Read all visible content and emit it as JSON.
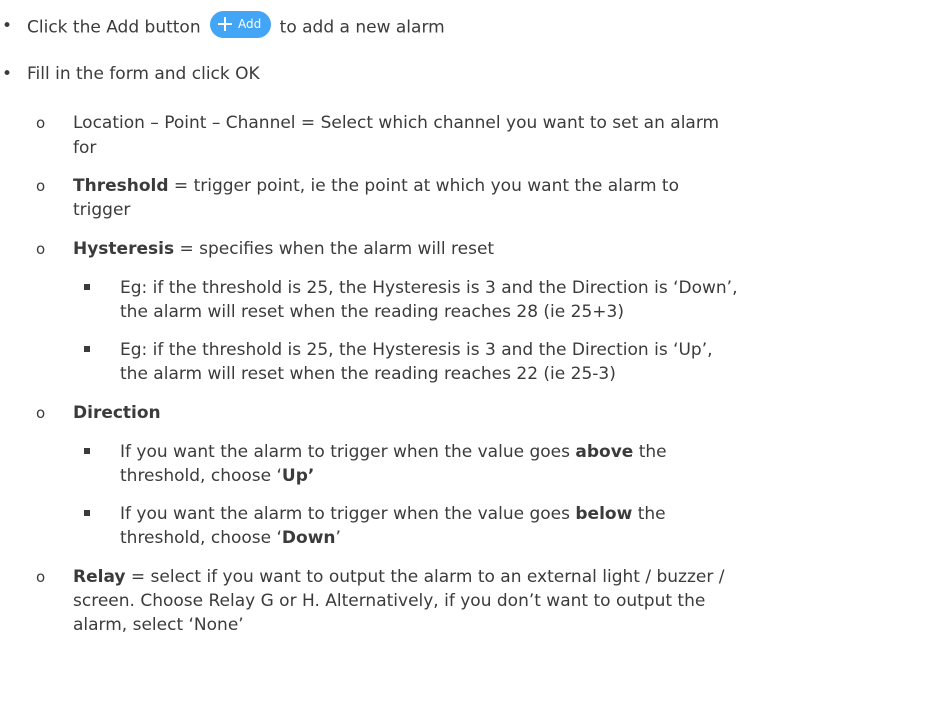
{
  "bullets": {
    "level1_marker": "•",
    "level2_marker": "o"
  },
  "step1": {
    "before": "Click the Add button",
    "button_label": "Add",
    "after": "to add a new alarm"
  },
  "step2": {
    "text": "Fill in the form and click OK"
  },
  "location": {
    "line1": "Location – Point – Channel = Select which channel you want to set an alarm",
    "line2": "for"
  },
  "threshold": {
    "term": "Threshold",
    "line1": " = trigger point, ie the point at which you want the alarm to",
    "line2": "trigger"
  },
  "hysteresis": {
    "term": "Hysteresis",
    "line1": " = specifies when the alarm will reset",
    "example_down": {
      "line1": "Eg: if the threshold is 25, the Hysteresis is 3 and the Direction is ‘Down’,",
      "line2": "the alarm will reset when the reading reaches 28 (ie 25+3)"
    },
    "example_up": {
      "line1": "Eg: if the threshold is 25, the Hysteresis is 3 and the Direction is ‘Up’,",
      "line2": "the alarm will reset when the reading reaches 22 (ie 25-3)"
    }
  },
  "direction": {
    "term": "Direction",
    "up": {
      "prefix": "If you want the alarm to trigger when the value goes ",
      "keyword": "above",
      "suffix": " the",
      "line2_prefix": "threshold, choose ‘",
      "choice": "Up’",
      "line2_suffix": ""
    },
    "down": {
      "prefix": "If you want the alarm to trigger when the value goes ",
      "keyword": "below",
      "suffix": " the",
      "line2_prefix": "threshold, choose ‘",
      "choice": "Down",
      "line2_suffix": "’"
    }
  },
  "relay": {
    "term": "Relay",
    "line1": " = select if you want to output the alarm to an external light / buzzer /",
    "line2": "screen. Choose Relay G or H. Alternatively, if you don’t want to output the",
    "line3": "alarm, select ‘None’"
  },
  "colors": {
    "text": "#3b3b3b",
    "add_button_bg": "#42a5f5",
    "add_button_text": "#ffffff"
  },
  "icons": {
    "add_button_icon": "plus-icon"
  }
}
